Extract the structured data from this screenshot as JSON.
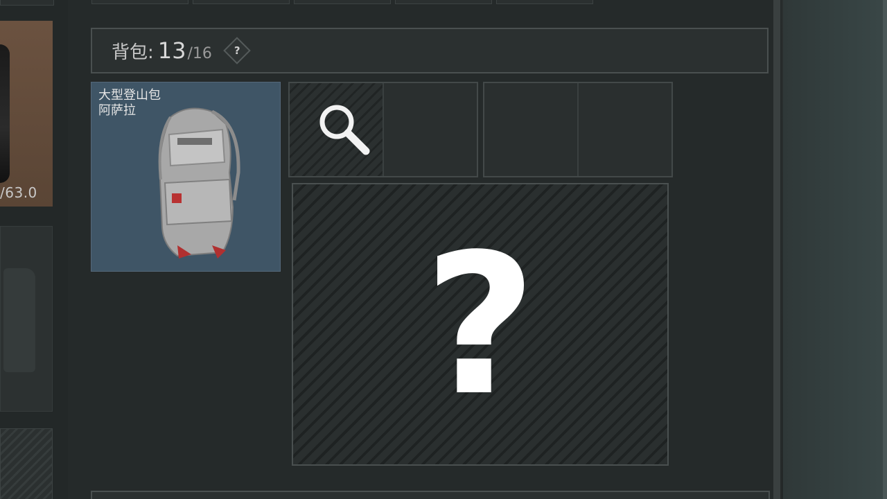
{
  "character": {
    "weight_text": "/63.0"
  },
  "backpack": {
    "label": "背包:",
    "count": "13",
    "capacity": "/16",
    "help": "?"
  },
  "bag_item": {
    "name_line1": "大型登山包",
    "name_line2": "阿萨拉"
  },
  "slots": {
    "search_icon": "search-icon",
    "unknown_mark": "?"
  },
  "colors": {
    "bag_card_bg": "#3f5566",
    "panel_bg": "#252a2a",
    "border": "#4a5050",
    "character_card_bg": "#6b5240"
  }
}
